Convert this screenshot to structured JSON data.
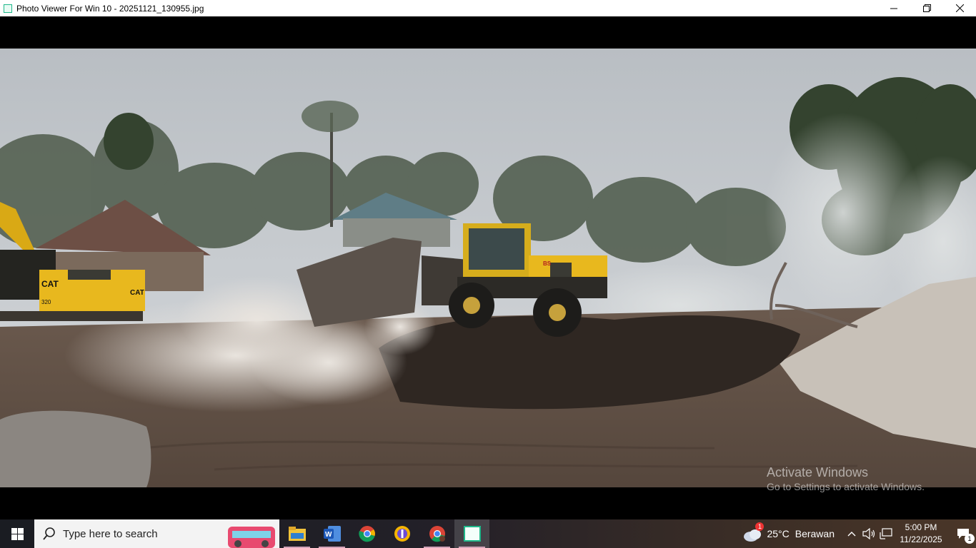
{
  "window": {
    "title": "Photo Viewer For Win 10 - 20251121_130955.jpg"
  },
  "photo": {
    "subject": "photo",
    "vehicle_labels": [
      "CAT",
      "320",
      "CAT",
      "BS"
    ]
  },
  "watermark": {
    "title": "Activate Windows",
    "subtitle": "Go to Settings to activate Windows."
  },
  "taskbar": {
    "search_placeholder": "Type here to search",
    "apps": [
      {
        "name": "file-explorer-icon"
      },
      {
        "name": "word-icon"
      },
      {
        "name": "chrome-icon"
      },
      {
        "name": "browser-icon"
      },
      {
        "name": "chrome-profile-icon"
      },
      {
        "name": "photo-viewer-icon"
      }
    ],
    "weather": {
      "badge": "1",
      "temperature": "25°C",
      "condition": "Berawan"
    },
    "clock": {
      "time": "5:00 PM",
      "date": "11/22/2025"
    },
    "notification_count": "1"
  },
  "colors": {
    "accent": "#1fb88a",
    "taskbar_underline": "#d2a3b8",
    "excavator_yellow": "#e8b81e"
  }
}
